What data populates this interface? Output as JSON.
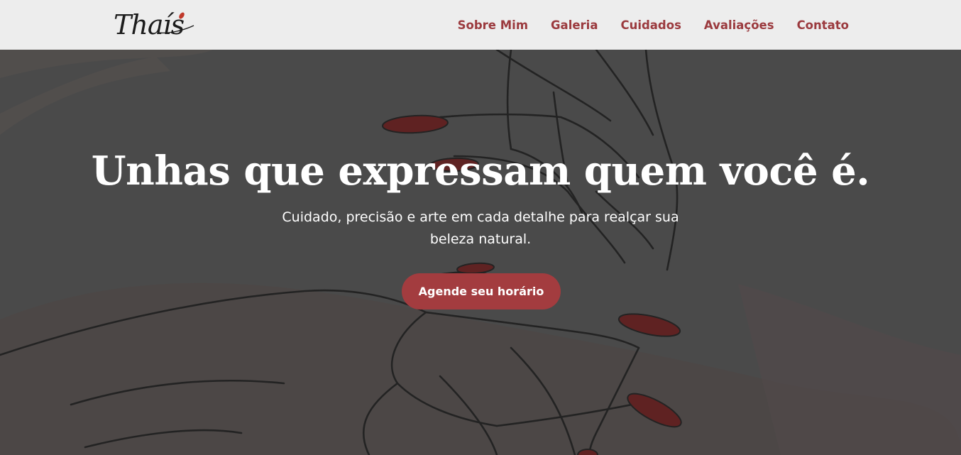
{
  "brand": {
    "logo_text": "Thaís",
    "accent_color": "#a33c3f",
    "nail_color": "#6b0d0d"
  },
  "nav": {
    "items": [
      {
        "label": "Sobre Mim"
      },
      {
        "label": "Galeria"
      },
      {
        "label": "Cuidados"
      },
      {
        "label": "Avaliações"
      },
      {
        "label": "Contato"
      }
    ]
  },
  "hero": {
    "title": "Unhas que expressam quem você é.",
    "subtitle": "Cuidado, precisão e arte em cada detalhe para realçar sua beleza natural.",
    "cta_label": "Agende seu horário",
    "background_image": "line-art-hands-with-red-nails"
  }
}
